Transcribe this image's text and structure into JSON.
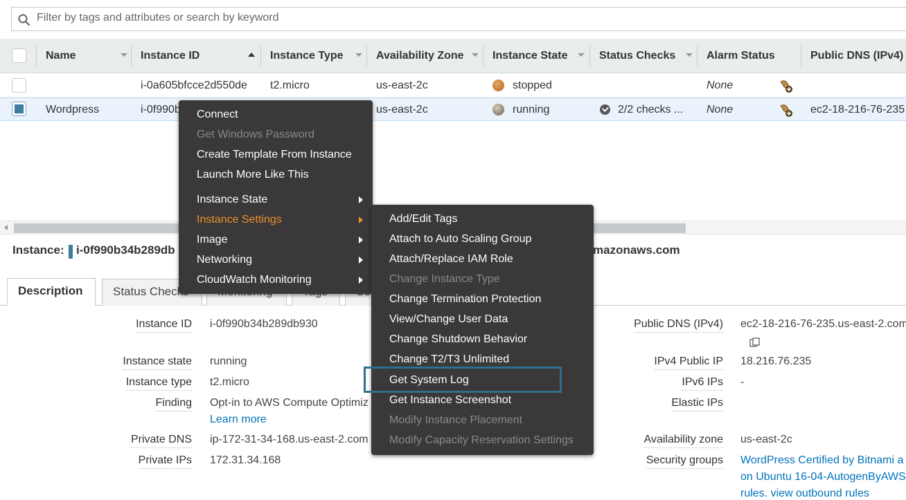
{
  "search": {
    "placeholder": "Filter by tags and attributes or search by keyword",
    "icon": "search-icon"
  },
  "table": {
    "columns": [
      "Name",
      "Instance ID",
      "Instance Type",
      "Availability Zone",
      "Instance State",
      "Status Checks",
      "Alarm Status",
      "Public DNS (IPv4)"
    ],
    "rows": [
      {
        "name": "",
        "instance_id": "i-0a605bfcce2d550de",
        "instance_type": "t2.micro",
        "zone": "us-east-2c",
        "state": "stopped",
        "status_checks": "",
        "alarm": "None",
        "public_dns": "",
        "selected": false
      },
      {
        "name": "Wordpress",
        "instance_id": "i-0f990b",
        "instance_type": "",
        "zone": "us-east-2c",
        "state": "running",
        "status_checks": "2/2 checks ...",
        "alarm": "None",
        "public_dns": "ec2-18-216-76-235",
        "selected": true
      }
    ]
  },
  "instance_header": {
    "label": "Instance:",
    "id": "i-0f990b34b289db",
    "dns_suffix": "mazonaws.com"
  },
  "tabs": [
    "Description",
    "Status Checks",
    "Monitoring",
    "Tags",
    "Us"
  ],
  "details_left": [
    {
      "label": "Instance ID",
      "value": "i-0f990b34b289db930"
    },
    {
      "label": "Instance state",
      "value": "running"
    },
    {
      "label": "Instance type",
      "value": "t2.micro"
    },
    {
      "label": "Finding",
      "value": "Opt-in to AWS Compute Optimiz",
      "link": "Learn more"
    },
    {
      "label": "Private DNS",
      "value": "ip-172-31-34-168.us-east-2.com"
    },
    {
      "label": "Private IPs",
      "value": "172.31.34.168"
    }
  ],
  "details_right": [
    {
      "label": "Public DNS (IPv4)",
      "value": "ec2-18-216-76-235.us-east-2.com"
    },
    {
      "label": "IPv4 Public IP",
      "value": "18.216.76.235"
    },
    {
      "label": "IPv6 IPs",
      "value": "-"
    },
    {
      "label": "Elastic IPs",
      "value": ""
    },
    {
      "label": "Availability zone",
      "value": "us-east-2c"
    },
    {
      "label": "Security groups",
      "value": "WordPress Certified by Bitnami a",
      "value2": "on Ubuntu 16-04-AutogenByAWS",
      "value3": "rules. view outbound rules"
    }
  ],
  "context_menu": {
    "items": [
      {
        "label": "Connect",
        "state": "enabled"
      },
      {
        "label": "Get Windows Password",
        "state": "disabled"
      },
      {
        "label": "Create Template From Instance",
        "state": "enabled"
      },
      {
        "label": "Launch More Like This",
        "state": "enabled"
      },
      {
        "label": "Instance State",
        "state": "enabled",
        "submenu": true
      },
      {
        "label": "Instance Settings",
        "state": "active",
        "submenu": true
      },
      {
        "label": "Image",
        "state": "enabled",
        "submenu": true
      },
      {
        "label": "Networking",
        "state": "enabled",
        "submenu": true
      },
      {
        "label": "CloudWatch Monitoring",
        "state": "enabled",
        "submenu": true
      }
    ]
  },
  "submenu": {
    "items": [
      {
        "label": "Add/Edit Tags",
        "state": "enabled"
      },
      {
        "label": "Attach to Auto Scaling Group",
        "state": "enabled"
      },
      {
        "label": "Attach/Replace IAM Role",
        "state": "enabled"
      },
      {
        "label": "Change Instance Type",
        "state": "disabled"
      },
      {
        "label": "Change Termination Protection",
        "state": "enabled"
      },
      {
        "label": "View/Change User Data",
        "state": "enabled"
      },
      {
        "label": "Change Shutdown Behavior",
        "state": "enabled"
      },
      {
        "label": "Change T2/T3 Unlimited",
        "state": "enabled"
      },
      {
        "label": "Get System Log",
        "state": "highlighted"
      },
      {
        "label": "Get Instance Screenshot",
        "state": "enabled"
      },
      {
        "label": "Modify Instance Placement",
        "state": "disabled"
      },
      {
        "label": "Modify Capacity Reservation Settings",
        "state": "disabled"
      }
    ]
  },
  "colors": {
    "menu_bg": "#3a3838",
    "menu_active": "#ec912d",
    "highlight_border": "#2e6f8c",
    "link": "#0073bb",
    "selected_row": "#eaf3fb"
  }
}
